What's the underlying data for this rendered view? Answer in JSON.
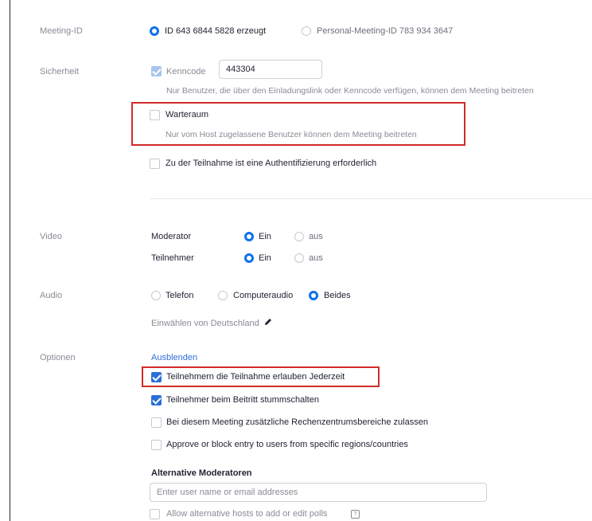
{
  "meeting_id": {
    "label": "Meeting-ID",
    "option_generated": "ID 643 6844 5828 erzeugt",
    "option_personal": "Personal-Meeting-ID 783 934 3647"
  },
  "security": {
    "label": "Sicherheit",
    "passcode_label": "Kenncode",
    "passcode_value": "443304",
    "passcode_hint": "Nur Benutzer, die über den Einladungslink oder Kenncode verfügen, können dem Meeting beitreten",
    "waiting_room_label": "Warteraum",
    "waiting_room_hint": "Nur vom Host zugelassene Benutzer können dem Meeting beitreten",
    "auth_label": "Zu der Teilnahme ist eine Authentifizierung erforderlich"
  },
  "video": {
    "label": "Video",
    "host_label": "Moderator",
    "participant_label": "Teilnehmer",
    "on_label": "Ein",
    "off_label": "aus"
  },
  "audio": {
    "label": "Audio",
    "phone": "Telefon",
    "computer": "Computeraudio",
    "both": "Beides",
    "dial_in": "Einwählen von Deutschland"
  },
  "options": {
    "label": "Optionen",
    "hide_link": "Ausblenden",
    "join_anytime": "Teilnehmern die Teilnahme erlauben Jederzeit",
    "mute_on_entry": "Teilnehmer beim Beitritt stummschalten",
    "data_center": "Bei diesem Meeting zusätzliche Rechenzentrumsbereiche zulassen",
    "approve_block": "Approve or block entry to users from specific regions/countries",
    "alt_hosts_title": "Alternative Moderatoren",
    "alt_hosts_placeholder": "Enter user name or email addresses",
    "allow_polls": "Allow alternative hosts to add or edit polls"
  },
  "colors": {
    "accent": "#0e72ed",
    "checkbox": "#2d6fd8",
    "highlight": "#d12b2b"
  }
}
